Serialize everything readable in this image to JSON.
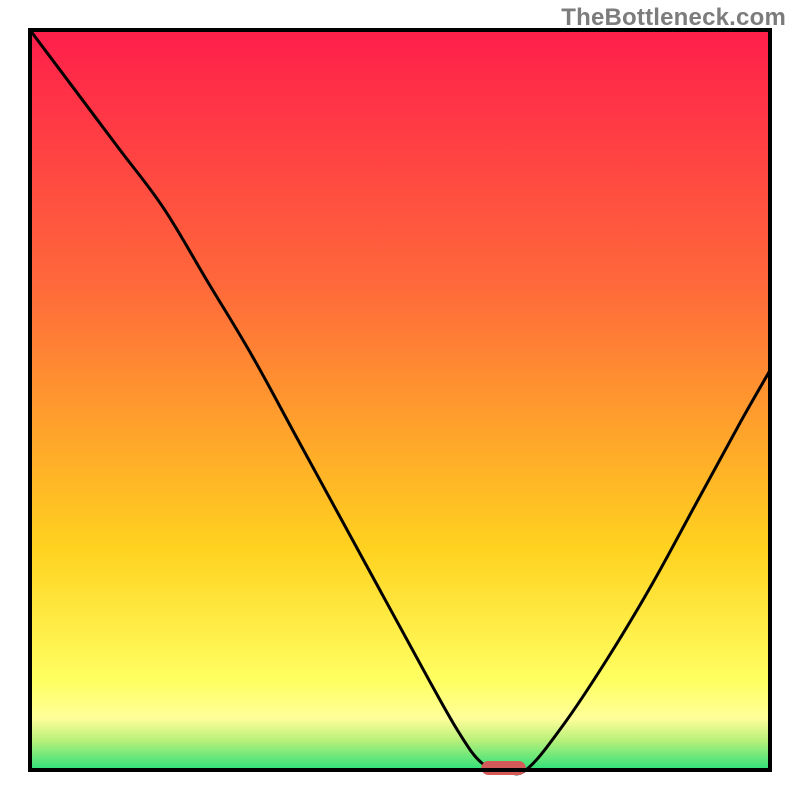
{
  "attribution": "TheBottleneck.com",
  "colors": {
    "top_gradient_start": "#ff1e4b",
    "mid_gradient_1": "#ff6a3a",
    "mid_gradient_2": "#ffd21f",
    "yellow_band": "#ffff9a",
    "green_band": "#2de07a",
    "curve": "#000000",
    "marker": "#d45a5a",
    "frame": "#000000"
  },
  "chart_data": {
    "type": "line",
    "title": "",
    "xlabel": "",
    "ylabel": "",
    "xlim": [
      0,
      100
    ],
    "ylim": [
      0,
      100
    ],
    "x": [
      0,
      6,
      12,
      18,
      24,
      30,
      36,
      42,
      48,
      54,
      58,
      61,
      64,
      67,
      72,
      78,
      84,
      90,
      96,
      100
    ],
    "values": [
      100,
      92,
      84,
      76,
      66,
      56,
      45,
      34,
      23,
      12,
      5,
      1,
      0,
      0,
      6,
      15,
      25,
      36,
      47,
      54
    ],
    "marker": {
      "x_start": 61,
      "x_end": 67,
      "y": 0
    },
    "annotations": []
  }
}
